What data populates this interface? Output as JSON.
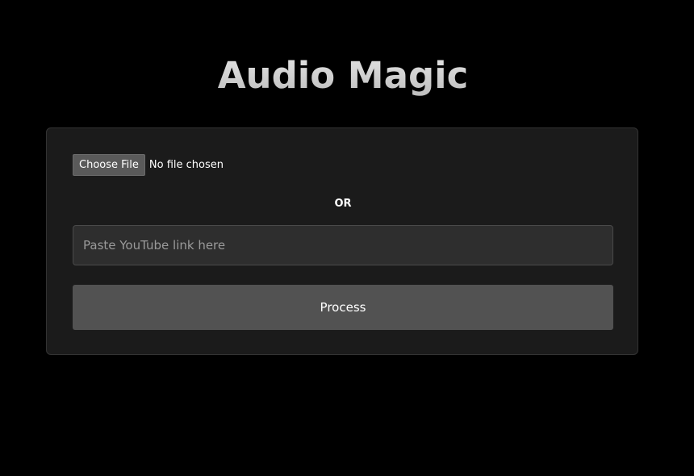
{
  "app": {
    "title": "Audio Magic"
  },
  "upload": {
    "choose_file_label": "Choose File",
    "file_status": "No file chosen"
  },
  "divider": {
    "or_label": "OR"
  },
  "youtube": {
    "value": "",
    "placeholder": "Paste YouTube link here"
  },
  "actions": {
    "process_label": "Process"
  },
  "colors": {
    "background": "#000000",
    "card": "#1b1b1b",
    "input": "#2e2e2e",
    "button": "#525252",
    "file_button": "#5a5a5a"
  }
}
